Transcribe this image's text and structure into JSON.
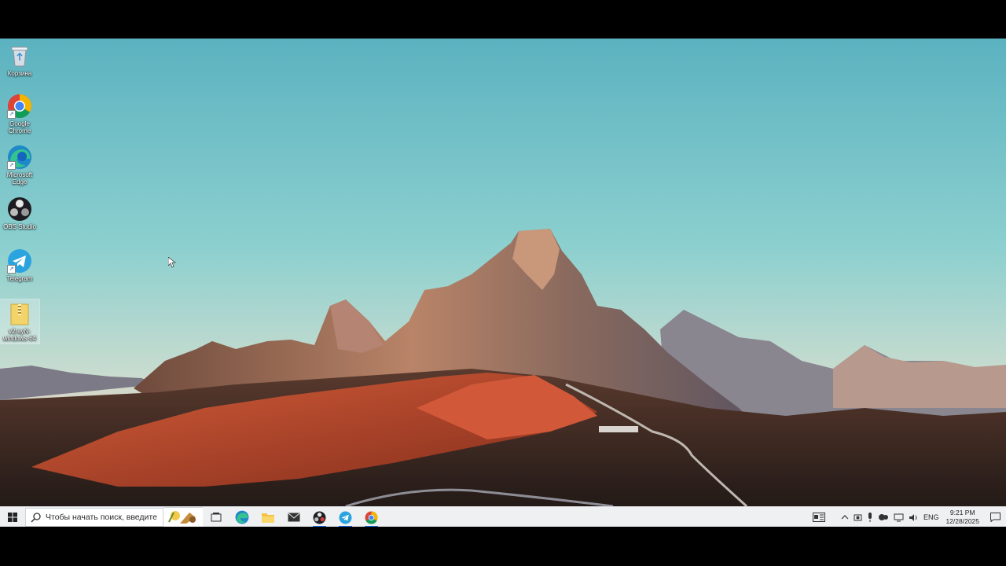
{
  "desktop": {
    "icons": [
      {
        "label": "Корзина",
        "icon": "recycle-bin-icon"
      },
      {
        "label": "Google Chrome",
        "icon": "chrome-icon"
      },
      {
        "label": "Microsoft Edge",
        "icon": "edge-icon"
      },
      {
        "label": "OBS Studio",
        "icon": "obs-icon"
      },
      {
        "label": "Telegram",
        "icon": "telegram-icon"
      },
      {
        "label": "v2rayN-windows-64",
        "icon": "folder-zip-icon"
      }
    ]
  },
  "taskbar": {
    "search_placeholder": "Чтобы начать поиск, введите",
    "apps": [
      "task-view-icon",
      "edge-icon",
      "file-explorer-icon",
      "mail-icon",
      "obs-icon",
      "telegram-icon",
      "chrome-icon"
    ],
    "tray": {
      "language": "ENG",
      "time": "9:21 PM",
      "date": "12/28/2025"
    }
  },
  "colors": {
    "sky_top": "#5fb4c1",
    "taskbar_bg": "#eef0f2",
    "accent": "#1a73e8"
  }
}
